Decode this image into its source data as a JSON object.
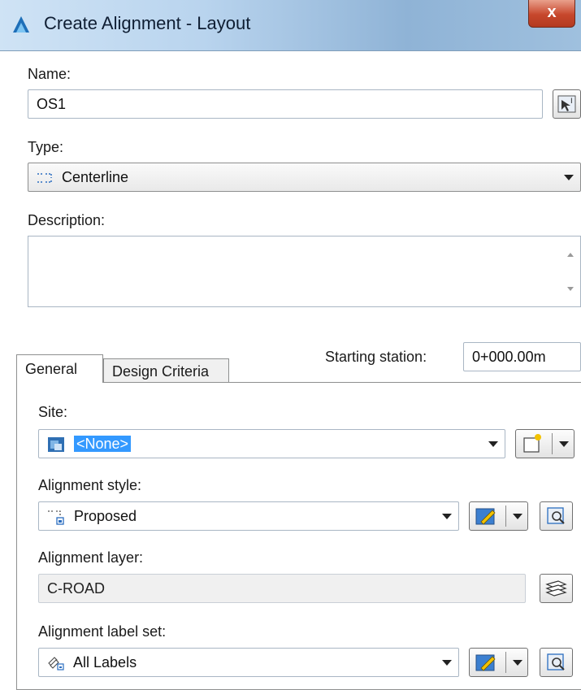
{
  "window": {
    "title": "Create Alignment - Layout",
    "close_label": "x"
  },
  "name": {
    "label": "Name:",
    "value": "OS1"
  },
  "type": {
    "label": "Type:",
    "selected": "Centerline"
  },
  "description": {
    "label": "Description:",
    "value": ""
  },
  "starting_station": {
    "label": "Starting station:",
    "value": "0+000.00m"
  },
  "tabs": [
    {
      "label": "General",
      "active": true
    },
    {
      "label": "Design Criteria",
      "active": false
    }
  ],
  "general": {
    "site": {
      "label": "Site:",
      "selected": "<None>"
    },
    "alignment_style": {
      "label": "Alignment style:",
      "selected": "Proposed"
    },
    "alignment_layer": {
      "label": "Alignment layer:",
      "value": "C-ROAD"
    },
    "alignment_label_set": {
      "label": "Alignment label set:",
      "selected": "All Labels"
    }
  },
  "colors": {
    "accent": "#3399ff",
    "close": "#c7472c"
  }
}
